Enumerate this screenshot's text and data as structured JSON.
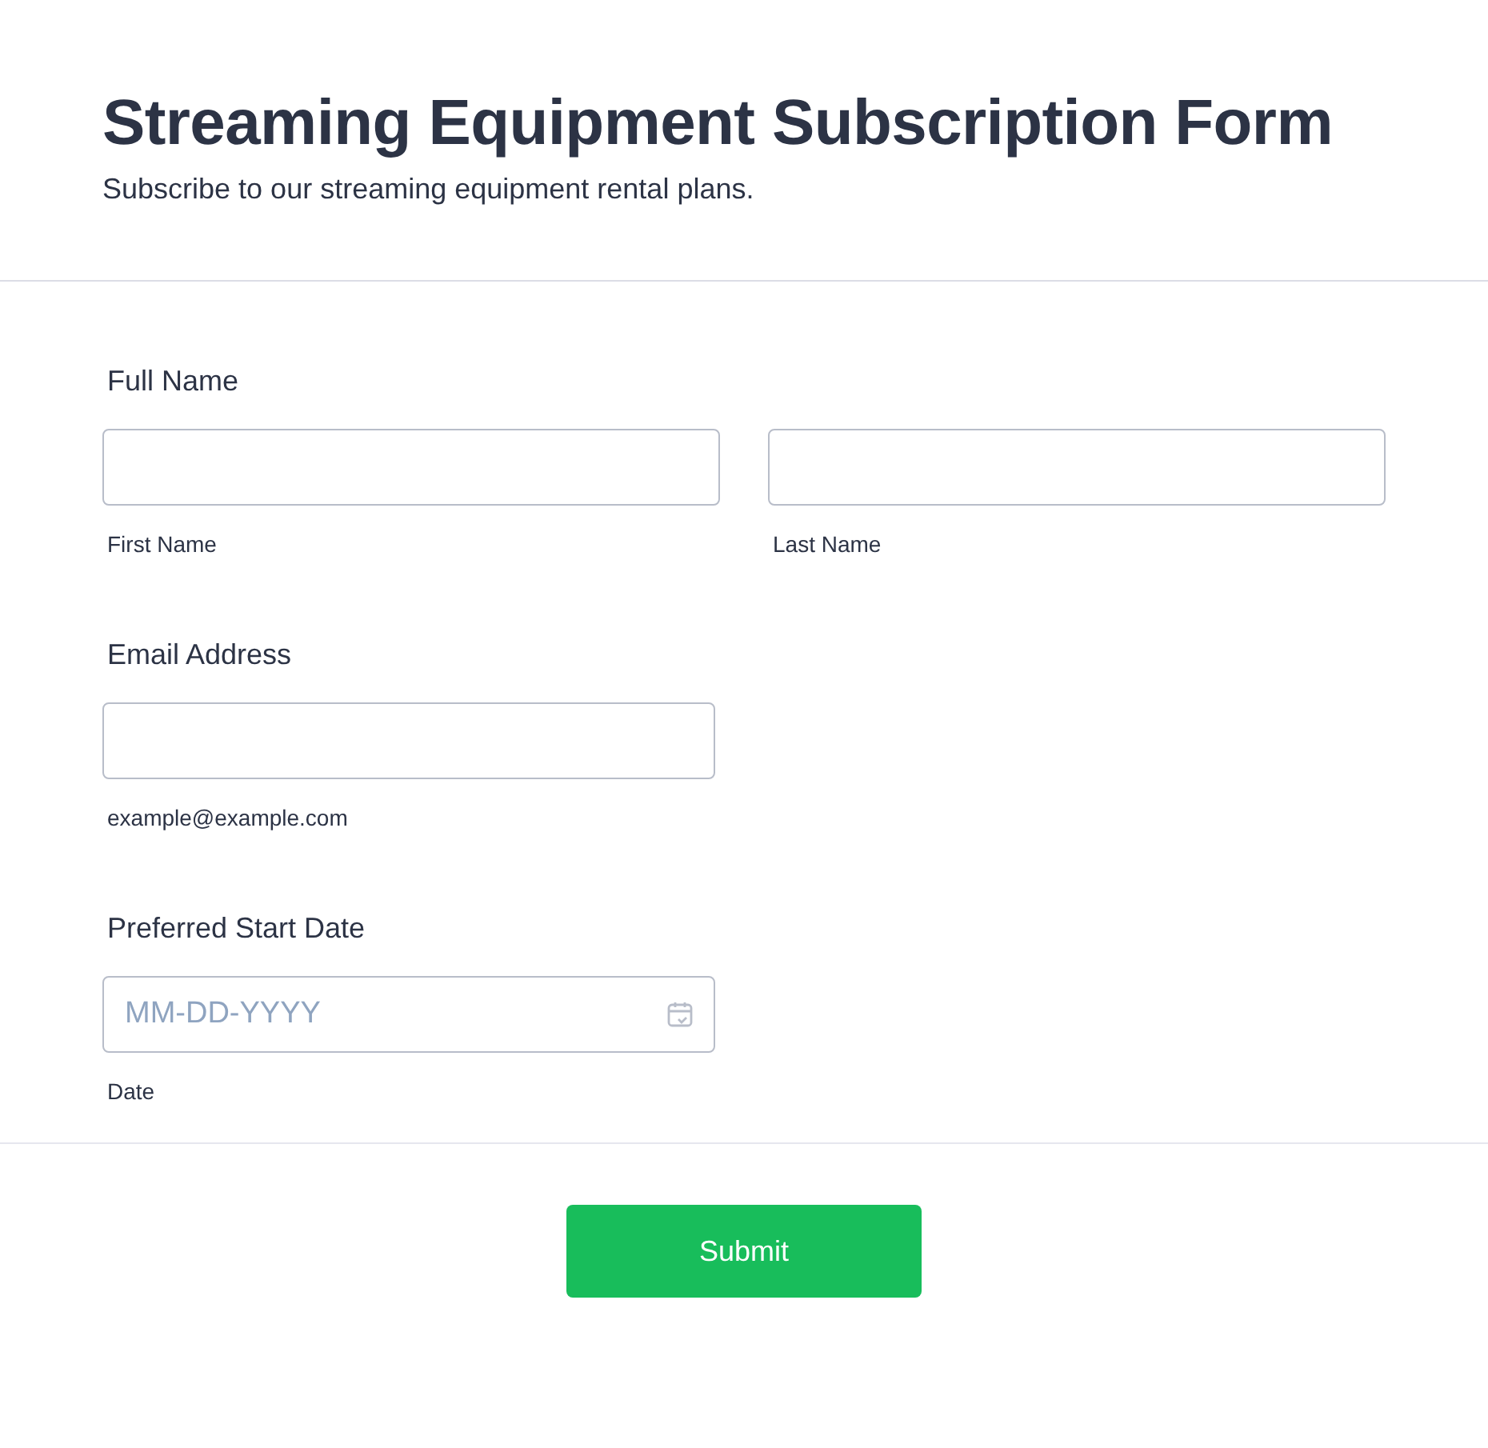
{
  "header": {
    "title": "Streaming Equipment Subscription Form",
    "subtitle": "Subscribe to our streaming equipment rental plans."
  },
  "fields": [
    {
      "kind": "split",
      "label": "Full Name",
      "inputs": [
        {
          "sublabel": "First Name"
        },
        {
          "sublabel": "Last Name"
        }
      ]
    },
    {
      "kind": "text",
      "label": "Email Address",
      "inputs": [
        {
          "sublabel": "example@example.com"
        }
      ]
    },
    {
      "kind": "date",
      "label": "Preferred Start Date",
      "inputs": [
        {
          "placeholder": "MM-DD-YYYY",
          "sublabel": "Date"
        }
      ]
    }
  ],
  "submit": {
    "label": "Submit"
  }
}
